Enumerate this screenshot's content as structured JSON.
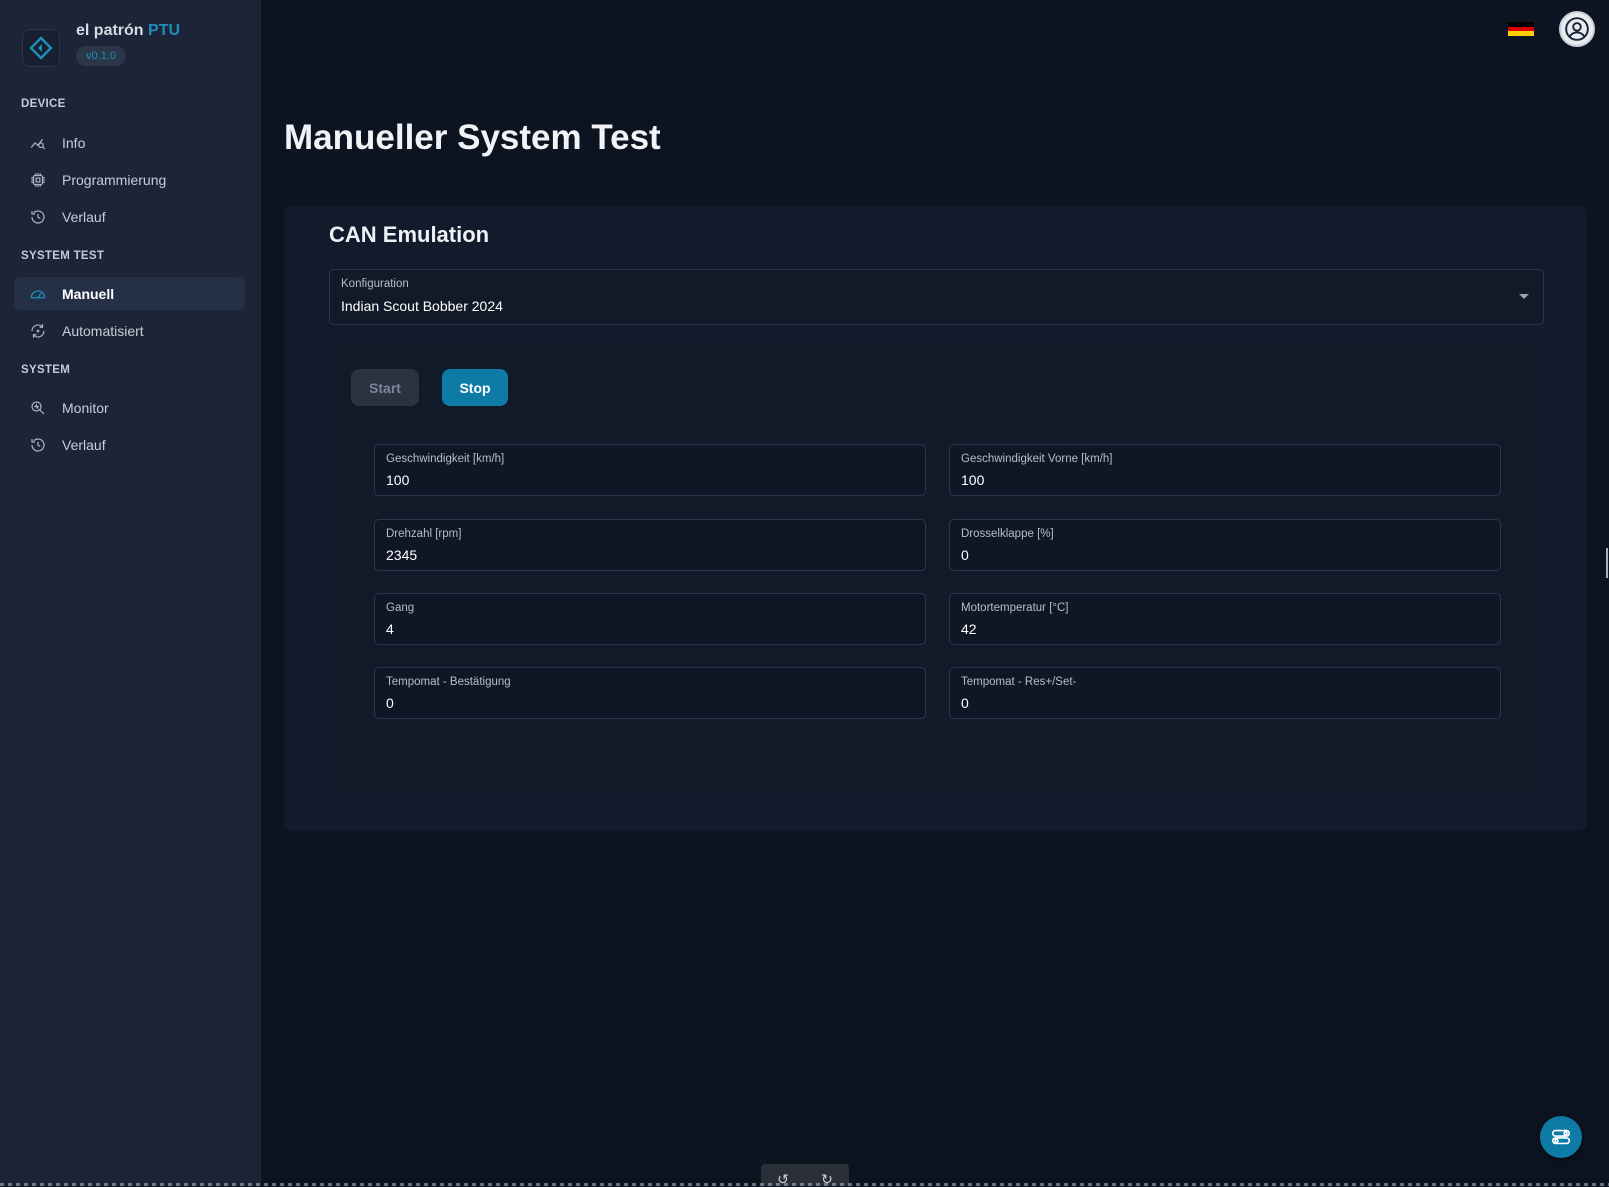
{
  "brand": {
    "name": "el patrón",
    "product": "PTU",
    "version": "v0.1.0",
    "accent_color": "#1f8dba"
  },
  "sidebar": {
    "sections": [
      {
        "title": "DEVICE",
        "items": [
          {
            "label": "Info",
            "icon": "chart-icon"
          },
          {
            "label": "Programmierung",
            "icon": "chip-icon"
          },
          {
            "label": "Verlauf",
            "icon": "history-icon"
          }
        ]
      },
      {
        "title": "SYSTEM TEST",
        "items": [
          {
            "label": "Manuell",
            "icon": "gauge-icon",
            "active": true
          },
          {
            "label": "Automatisiert",
            "icon": "auto-cycle-icon"
          }
        ]
      },
      {
        "title": "SYSTEM",
        "items": [
          {
            "label": "Monitor",
            "icon": "magnifier-icon"
          },
          {
            "label": "Verlauf",
            "icon": "history-icon"
          }
        ]
      }
    ]
  },
  "topbar": {
    "language_flag": "german-flag-icon",
    "user_icon": "user-avatar-icon"
  },
  "page": {
    "title": "Manueller System Test"
  },
  "can_emulation": {
    "title": "CAN Emulation",
    "configuration": {
      "label": "Konfiguration",
      "value": "Indian Scout Bobber 2024"
    },
    "buttons": {
      "start": "Start",
      "stop": "Stop"
    },
    "fields": [
      {
        "label": "Geschwindigkeit [km/h]",
        "value": "100"
      },
      {
        "label": "Geschwindigkeit Vorne [km/h]",
        "value": "100"
      },
      {
        "label": "Drehzahl [rpm]",
        "value": "2345"
      },
      {
        "label": "Drosselklappe [%]",
        "value": "0"
      },
      {
        "label": "Gang",
        "value": "4"
      },
      {
        "label": "Motortemperatur [°C]",
        "value": "42"
      },
      {
        "label": "Tempomat - Bestätigung",
        "value": "0"
      },
      {
        "label": "Tempomat - Res+/Set-",
        "value": "0"
      }
    ]
  },
  "floating": {
    "fab_icon": "settings-toggle-icon",
    "toolbar": [
      "undo-icon",
      "redo-icon"
    ]
  }
}
